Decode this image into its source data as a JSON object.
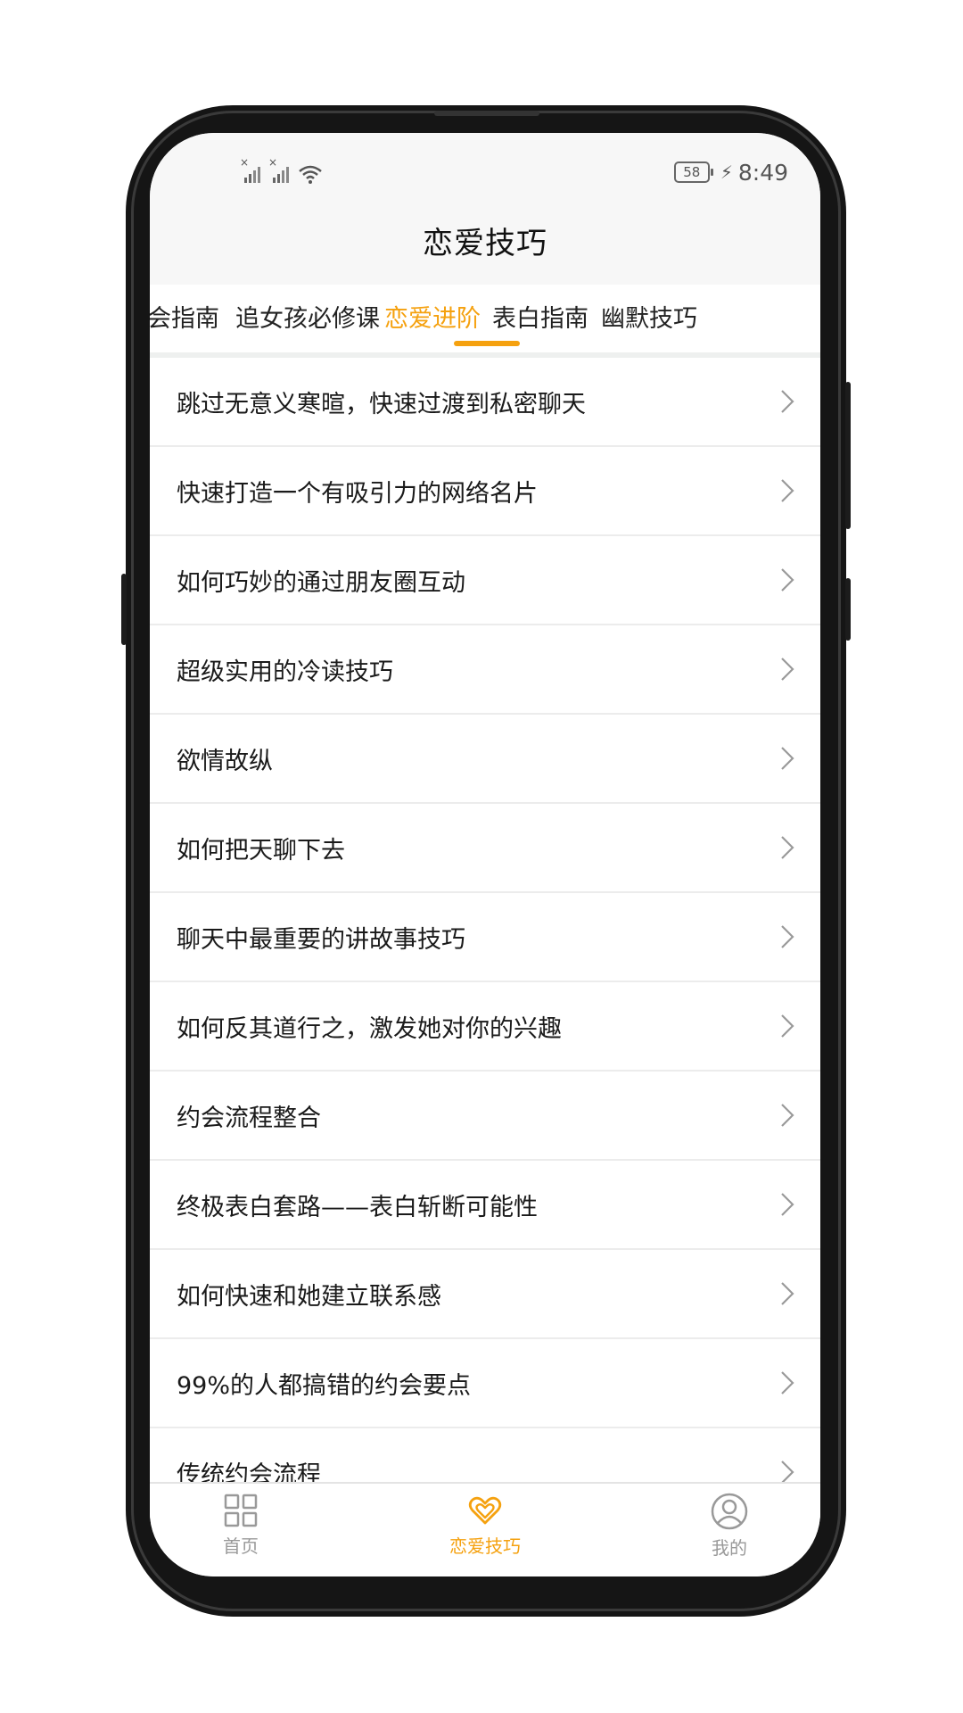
{
  "status_bar": {
    "battery_level": "58",
    "time": "8:49"
  },
  "header": {
    "title": "恋爱技巧"
  },
  "tabs": [
    {
      "label": "会指南",
      "active": false
    },
    {
      "label": "追女孩必修课",
      "active": false
    },
    {
      "label": "恋爱进阶",
      "active": true
    },
    {
      "label": "表白指南",
      "active": false
    },
    {
      "label": "幽默技巧",
      "active": false
    }
  ],
  "articles": [
    {
      "title": "跳过无意义寒暄，快速过渡到私密聊天"
    },
    {
      "title": "快速打造一个有吸引力的网络名片"
    },
    {
      "title": "如何巧妙的通过朋友圈互动"
    },
    {
      "title": "超级实用的冷读技巧"
    },
    {
      "title": "欲情故纵"
    },
    {
      "title": "如何把天聊下去"
    },
    {
      "title": "聊天中最重要的讲故事技巧"
    },
    {
      "title": "如何反其道行之，激发她对你的兴趣"
    },
    {
      "title": "约会流程整合"
    },
    {
      "title": "终极表白套路——表白斩断可能性"
    },
    {
      "title": "如何快速和她建立联系感"
    },
    {
      "title": "99%的人都搞错的约会要点"
    },
    {
      "title": "传统约会流程"
    }
  ],
  "bottom_nav": [
    {
      "label": "首页",
      "icon": "grid-icon",
      "active": false
    },
    {
      "label": "恋爱技巧",
      "icon": "hearts-icon",
      "active": true
    },
    {
      "label": "我的",
      "icon": "user-icon",
      "active": false
    }
  ],
  "colors": {
    "accent": "#f5a10f",
    "text": "#1a1a1a",
    "inactive": "#999999"
  }
}
